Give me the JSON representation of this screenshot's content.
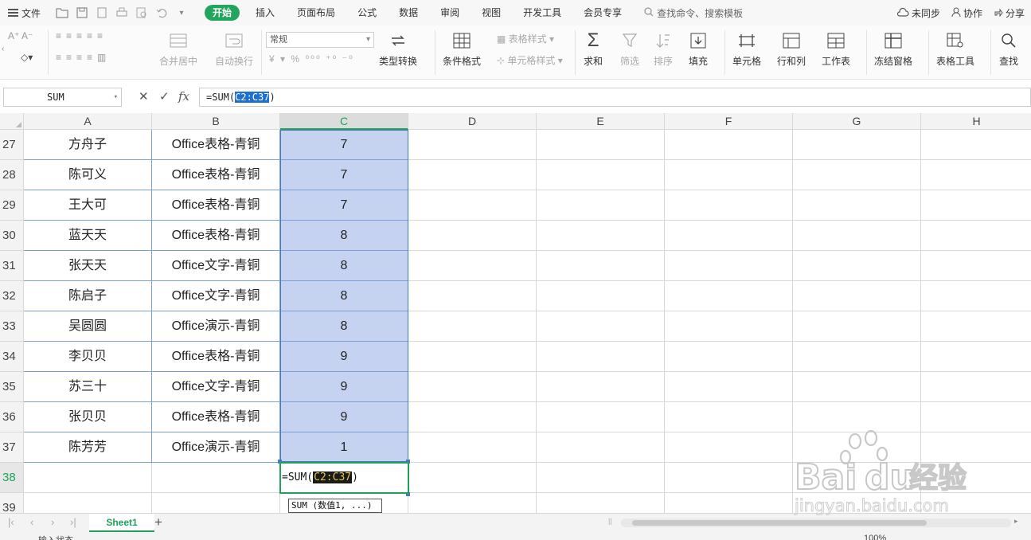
{
  "menubar": {
    "file_label": "文件",
    "tabs": [
      {
        "label": "开始",
        "active": true
      },
      {
        "label": "插入"
      },
      {
        "label": "页面布局"
      },
      {
        "label": "公式"
      },
      {
        "label": "数据"
      },
      {
        "label": "审阅"
      },
      {
        "label": "视图"
      },
      {
        "label": "开发工具"
      },
      {
        "label": "会员专享"
      }
    ],
    "search_placeholder": "查找命令、搜索模板",
    "sync_label": "未同步",
    "collab_label": "协作",
    "share_label": "分享"
  },
  "ribbon": {
    "merge_label": "合并居中",
    "wrap_label": "自动换行",
    "number_format": "常规",
    "convert_label": "类型转换",
    "cond_format_label": "条件格式",
    "table_style_label": "表格样式",
    "cell_style_label": "单元格样式",
    "sum_label": "求和",
    "filter_label": "筛选",
    "sort_label": "排序",
    "fill_label": "填充",
    "cell_label": "单元格",
    "rowcol_label": "行和列",
    "sheet_label": "工作表",
    "freeze_label": "冻结窗格",
    "table_tools_label": "表格工具",
    "find_label": "查找"
  },
  "formula_bar": {
    "name_box": "SUM",
    "prefix": "=SUM(",
    "range": "C2:C37",
    "suffix": ")"
  },
  "grid": {
    "columns": [
      "A",
      "B",
      "C",
      "D",
      "E",
      "F",
      "G",
      "H"
    ],
    "rows": [
      {
        "num": "27",
        "a": "方舟子",
        "b": "Office表格-青铜",
        "c": "7"
      },
      {
        "num": "28",
        "a": "陈可义",
        "b": "Office表格-青铜",
        "c": "7"
      },
      {
        "num": "29",
        "a": "王大可",
        "b": "Office表格-青铜",
        "c": "7"
      },
      {
        "num": "30",
        "a": "蓝天天",
        "b": "Office表格-青铜",
        "c": "8"
      },
      {
        "num": "31",
        "a": "张天天",
        "b": "Office文字-青铜",
        "c": "8"
      },
      {
        "num": "32",
        "a": "陈启子",
        "b": "Office文字-青铜",
        "c": "8"
      },
      {
        "num": "33",
        "a": "吴圆圆",
        "b": "Office演示-青铜",
        "c": "8"
      },
      {
        "num": "34",
        "a": "李贝贝",
        "b": "Office表格-青铜",
        "c": "9"
      },
      {
        "num": "35",
        "a": "苏三十",
        "b": "Office文字-青铜",
        "c": "9"
      },
      {
        "num": "36",
        "a": "张贝贝",
        "b": "Office表格-青铜",
        "c": "9"
      },
      {
        "num": "37",
        "a": "陈芳芳",
        "b": "Office演示-青铜",
        "c": "1"
      }
    ],
    "edit_row": "38",
    "tail_row": "39",
    "edit_prefix": "=SUM(",
    "edit_range": "C2:C37",
    "edit_suffix": ")",
    "tooltip": "SUM (数值1, ...)"
  },
  "sheets": {
    "active": "Sheet1",
    "add": "+"
  },
  "status": {
    "left": "输入状态",
    "zoom": "100%"
  },
  "watermark": {
    "brand": "Bai",
    "brand2": "du",
    "cn": "经验",
    "url": "jingyan.baidu.com"
  }
}
